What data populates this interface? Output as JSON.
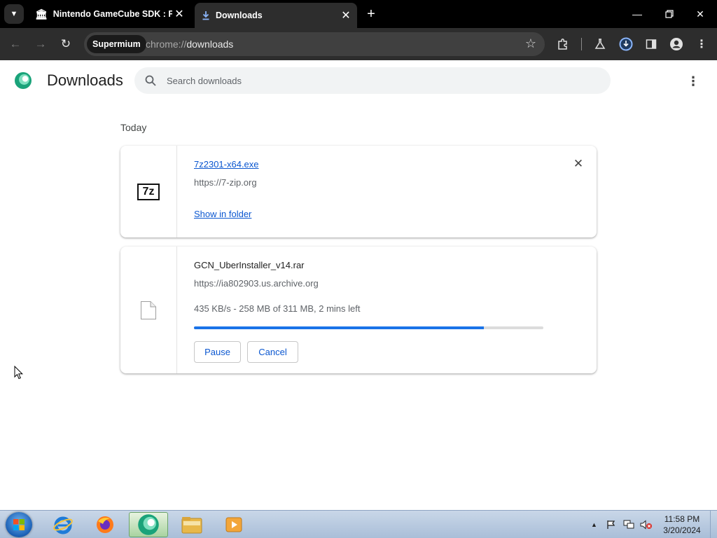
{
  "browser": {
    "tabs": [
      {
        "title": "Nintendo GameCube SDK : Free",
        "active": false
      },
      {
        "title": "Downloads",
        "active": true
      }
    ],
    "omnibox": {
      "chip": "Supermium",
      "url_scheme": "chrome://",
      "url_path": "downloads"
    }
  },
  "page": {
    "title": "Downloads",
    "search_placeholder": "Search downloads",
    "section": "Today",
    "downloads": [
      {
        "filename": "7z2301-x64.exe",
        "source": "https://7-zip.org",
        "action": "Show in folder",
        "icon_text": "7z"
      },
      {
        "filename": "GCN_UberInstaller_v14.rar",
        "source": "https://ia802903.us.archive.org",
        "status": "435 KB/s - 258 MB of 311 MB, 2 mins left",
        "progress_percent": 83,
        "pause_label": "Pause",
        "cancel_label": "Cancel"
      }
    ]
  },
  "taskbar": {
    "time": "11:58 PM",
    "date": "3/20/2024"
  },
  "colors": {
    "accent": "#0b57d0",
    "progress": "#1a73e8"
  }
}
